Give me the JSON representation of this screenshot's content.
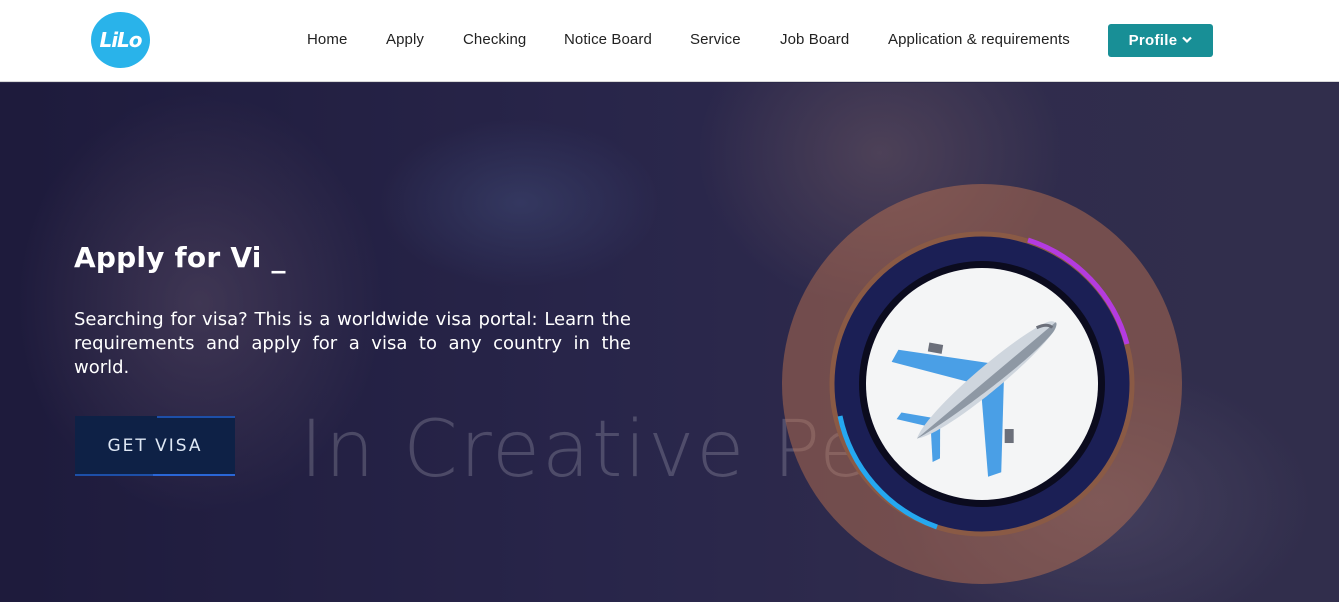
{
  "header": {
    "logo_text": "LiLo",
    "nav": [
      {
        "label": "Home"
      },
      {
        "label": "Apply"
      },
      {
        "label": "Checking"
      },
      {
        "label": "Notice Board"
      },
      {
        "label": "Service"
      },
      {
        "label": "Job Board"
      },
      {
        "label": "Application & requirements"
      }
    ],
    "profile_label": "Profile",
    "profile_icon": "chevron-down-icon"
  },
  "hero": {
    "title": "Apply for Vi _",
    "description": "Searching for visa? This is a worldwide visa portal: Learn the requirements and apply for a visa to any country in the world.",
    "button_label": "GET VISA",
    "watermark": "In Creative Pe",
    "graphic_icon": "airplane-icon"
  },
  "colors": {
    "logo": "#29b3ea",
    "profile_button": "#188f96",
    "button_bg": "#0e2146",
    "ring_accent_purple": "#b43be0",
    "ring_accent_blue": "#25a8f0"
  }
}
